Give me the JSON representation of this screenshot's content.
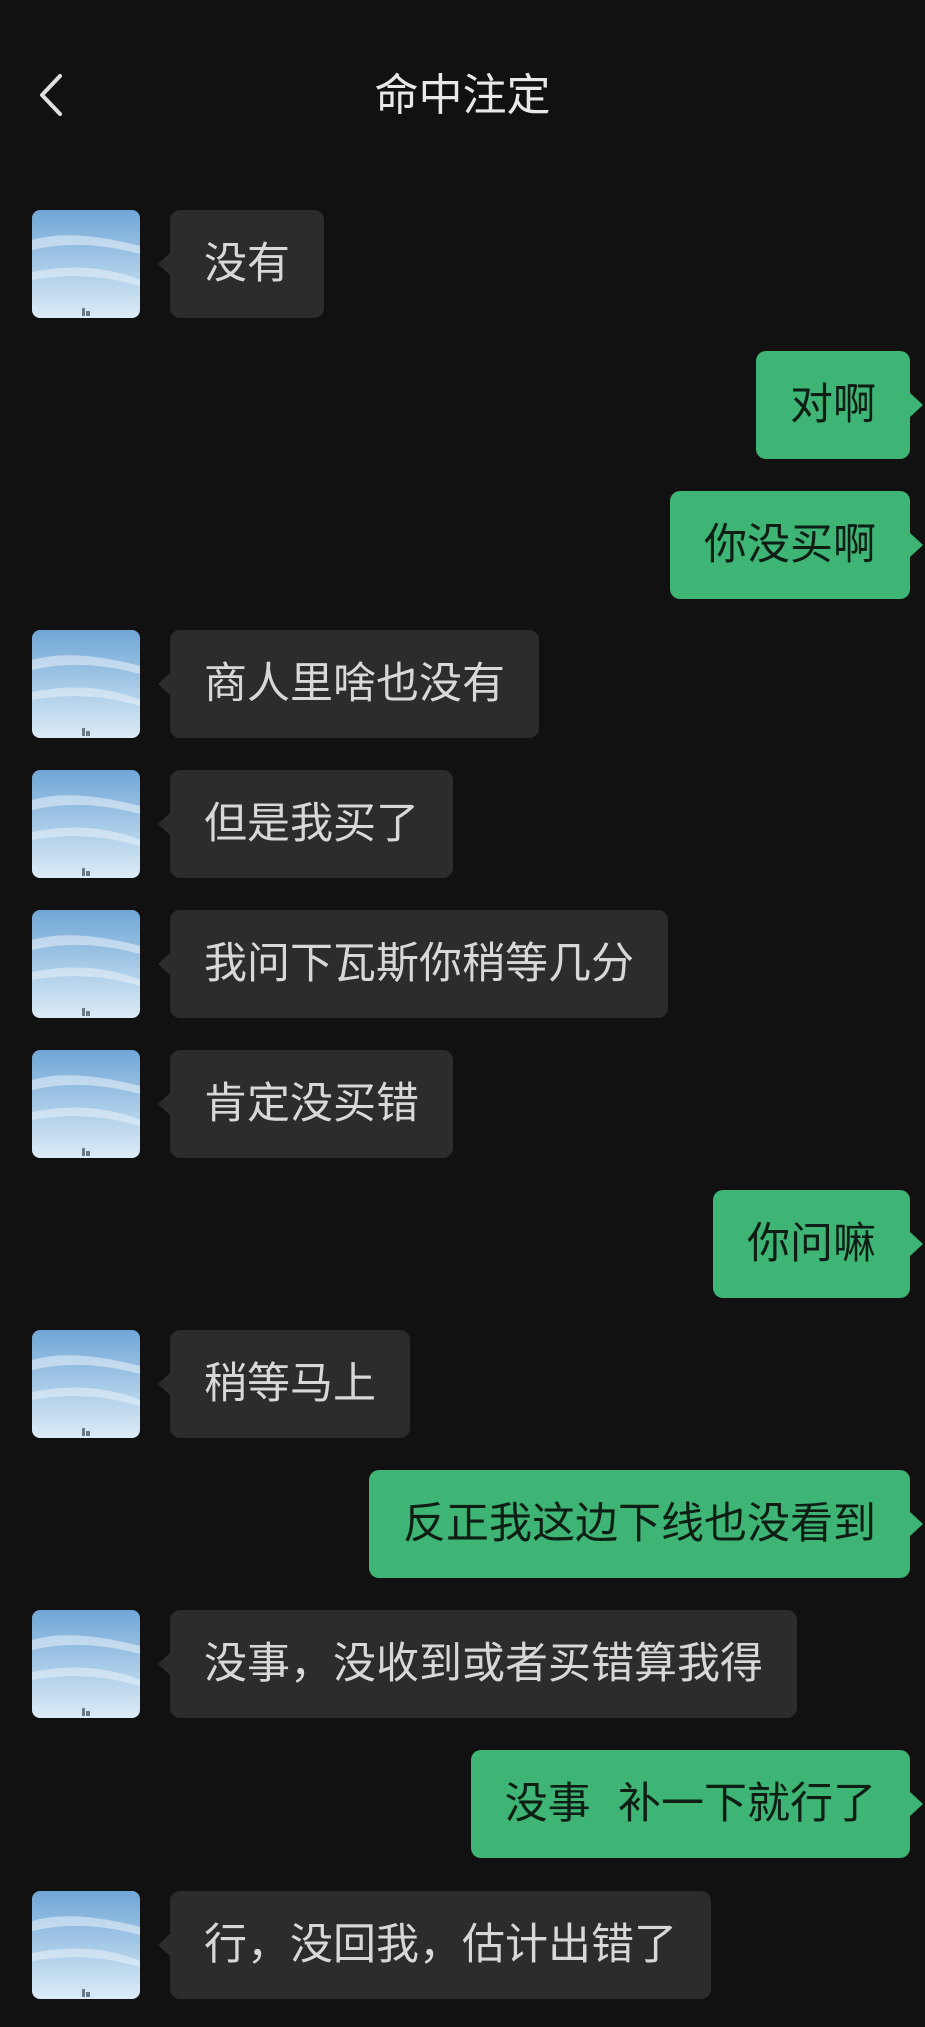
{
  "header": {
    "title": "命中注定",
    "back_icon": "chevron-left-icon"
  },
  "colors": {
    "background": "#111111",
    "incoming_bubble": "#2c2c2c",
    "outgoing_bubble": "#3eb575"
  },
  "messages": [
    {
      "side": "in",
      "text": "没有"
    },
    {
      "side": "out",
      "text": "对啊"
    },
    {
      "side": "out",
      "text": "你没买啊"
    },
    {
      "side": "in",
      "text": "商人里啥也没有"
    },
    {
      "side": "in",
      "text": "但是我买了"
    },
    {
      "side": "in",
      "text": "我问下瓦斯你稍等几分"
    },
    {
      "side": "in",
      "text": "肯定没买错"
    },
    {
      "side": "out",
      "text": "你问嘛"
    },
    {
      "side": "in",
      "text": "稍等马上"
    },
    {
      "side": "out",
      "text": "反正我这边下线也没看到"
    },
    {
      "side": "in",
      "text": "没事，没收到或者买错算我得"
    },
    {
      "side": "out",
      "text": "没事  补一下就行了"
    },
    {
      "side": "in",
      "text": "行，没回我，估计出错了"
    }
  ]
}
